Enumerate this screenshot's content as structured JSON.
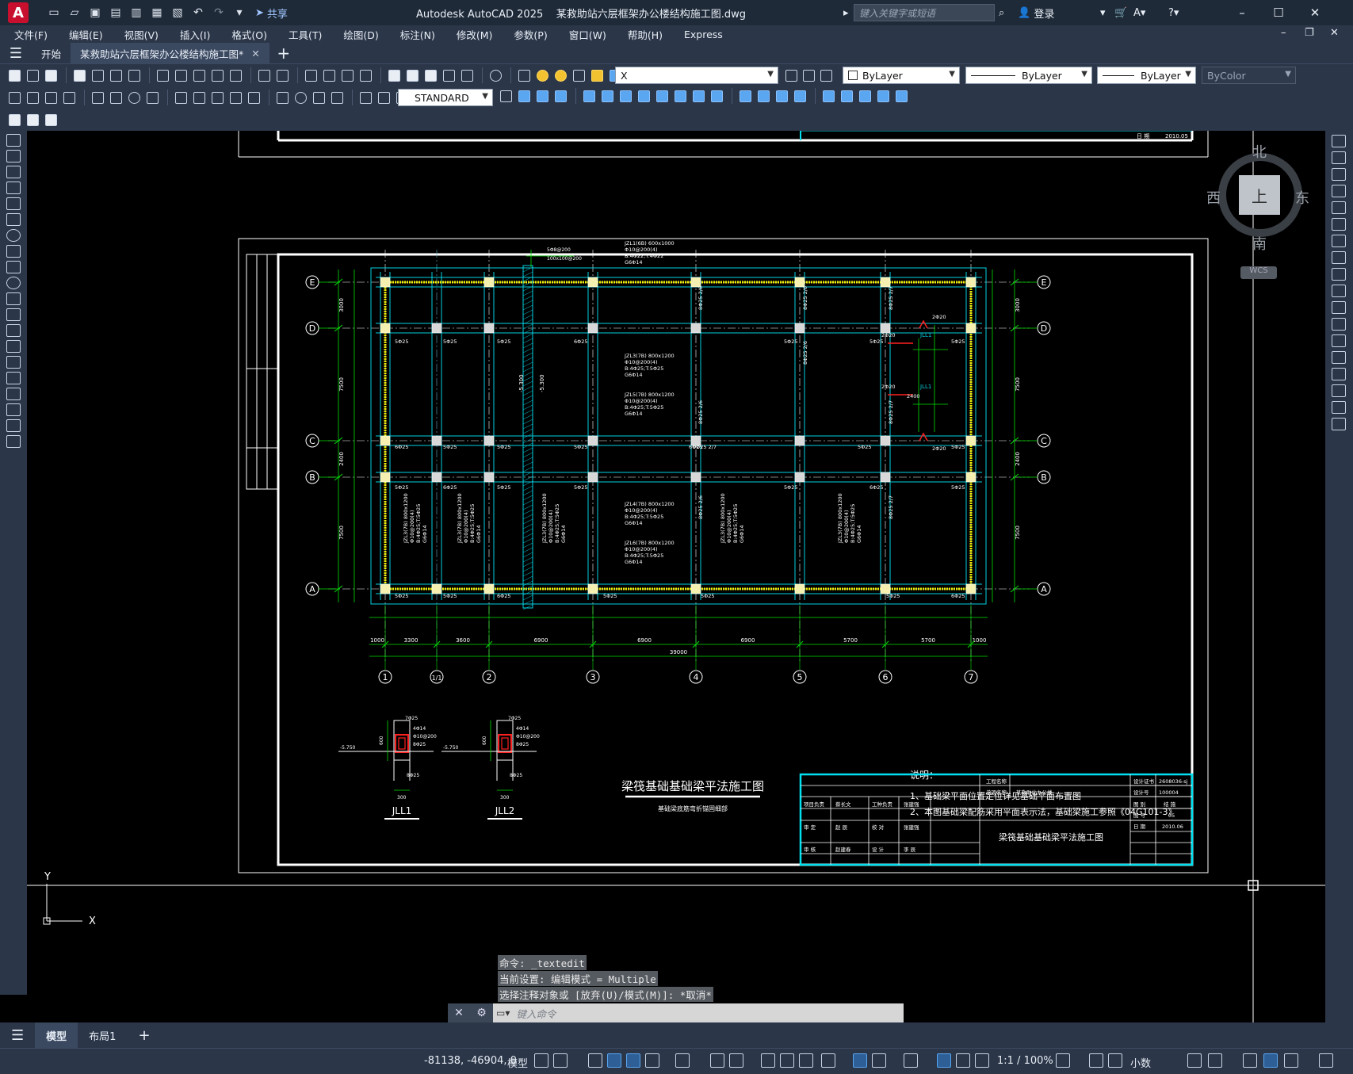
{
  "window": {
    "app_title": "Autodesk AutoCAD 2025",
    "file_title": "某救助站六层框架办公楼结构施工图.dwg",
    "search_placeholder": "键入关键字或短语",
    "login_label": "登录",
    "share_label": "共享"
  },
  "menu": [
    "文件(F)",
    "编辑(E)",
    "视图(V)",
    "插入(I)",
    "格式(O)",
    "工具(T)",
    "绘图(D)",
    "标注(N)",
    "修改(M)",
    "参数(P)",
    "窗口(W)",
    "帮助(H)",
    "Express"
  ],
  "tabs": {
    "start": "开始",
    "active": "某救助站六层框架办公楼结构施工图*"
  },
  "properties": {
    "layer": "X",
    "color": "ByLayer",
    "linetype": "ByLayer",
    "lineweight": "ByLayer",
    "plotstyle": "ByColor",
    "text_style": "STANDARD"
  },
  "viewcube": {
    "north": "北",
    "south": "南",
    "east": "东",
    "west": "西",
    "top": "上",
    "wcs": "WCS"
  },
  "drawing": {
    "title": "梁筏基础基础梁平法施工图",
    "subtitle": "基础梁底筋弯折锚固细部",
    "notes_title": "说明：",
    "notes": [
      "1、基础梁平面位置定位详见基础平面布置图",
      "2、本图基础梁配筋采用平面表示法，基础梁施工参照《04G101-3》"
    ],
    "row_axes": [
      "E",
      "D",
      "C",
      "B",
      "A"
    ],
    "col_axes": [
      "1",
      "1/1",
      "2",
      "3",
      "4",
      "5",
      "6",
      "7"
    ],
    "col_dims": [
      "1000",
      "3300",
      "3600",
      "6900",
      "6900",
      "5700",
      "5700",
      "1000"
    ],
    "total_dim": "39000",
    "row_dims": [
      "3000",
      "7500",
      "2400",
      "7500"
    ],
    "beams": {
      "jzl1": [
        "JZL1(6B) 600x1000",
        "Φ10@200(4)",
        "B:4Φ22;T:4Φ22",
        "G6Φ14"
      ],
      "jzl3": [
        "JZL3(7B) 800x1200",
        "Φ10@200(4)",
        "B:4Φ25;T:5Φ25",
        "G6Φ14"
      ],
      "jzl5": [
        "JZL5(7B) 800x1200",
        "Φ10@200(4)",
        "B:4Φ25;T:5Φ25",
        "G6Φ14"
      ],
      "jzl4": [
        "JZL4(7B) 800x1200",
        "Φ10@200(4)",
        "B:4Φ25;T:5Φ25",
        "G6Φ14"
      ],
      "jzl6": [
        "JZL6(7B) 800x1200",
        "Φ10@200(4)",
        "B:4Φ25;T:5Φ25",
        "G6Φ14"
      ]
    },
    "rebar_labels": [
      "5Φ25",
      "6Φ25",
      "7Φ25",
      "9Φ25 2/7",
      "8Φ25 2/6",
      "8Φ25 2/7"
    ],
    "sections": [
      "JLL1",
      "JLL2"
    ],
    "section_texts": [
      "7Φ25",
      "4Φ14",
      "Φ10@200",
      "8Φ25",
      "600",
      "300",
      "-5.750"
    ],
    "elevations": [
      "-5.300",
      "-5.300"
    ],
    "titleblock": {
      "project_label": "工程名称",
      "item_label": "单项名称",
      "item_value": "某救助站办公楼",
      "drawing_name": "梁筏基础基础梁平法施工图",
      "cert_label": "设计证书",
      "cert_no": "2608036-sj",
      "design_no_label": "设计号",
      "design_no": "100004",
      "drawing_type_label": "图 别",
      "drawing_type": "结 施",
      "sheet_no_label": "图 号",
      "sheet_no": "05",
      "date_label": "日 期",
      "date": "2010.06",
      "roles": [
        [
          "项目负责",
          "蔡长文",
          "工种负责",
          "张建强"
        ],
        [
          "审 定",
          "赵 辰",
          "校 对",
          "张建强"
        ],
        [
          "审 核",
          "赵建春",
          "设 计",
          "李 辰"
        ]
      ]
    },
    "top_sheet_date": "2010.05",
    "top_sheet_date_label": "日 期"
  },
  "command": {
    "history": [
      "命令: _textedit",
      "当前设置: 编辑模式 = Multiple",
      "选择注释对象或 [放弃(U)/模式(M)]: *取消*"
    ],
    "placeholder": "键入命令"
  },
  "layout_tabs": [
    "模型",
    "布局1"
  ],
  "status": {
    "coords": "-81138, -46904, 0",
    "space": "模型",
    "scale": "1:1 / 100%",
    "units": "小数"
  },
  "colors": {
    "chrome": "#2b3648",
    "canvas": "#000000",
    "grid_cyan": "#00d0e0",
    "dim_green": "#00e000",
    "beam_yellow": "#f0f000",
    "red": "#ff2020"
  }
}
